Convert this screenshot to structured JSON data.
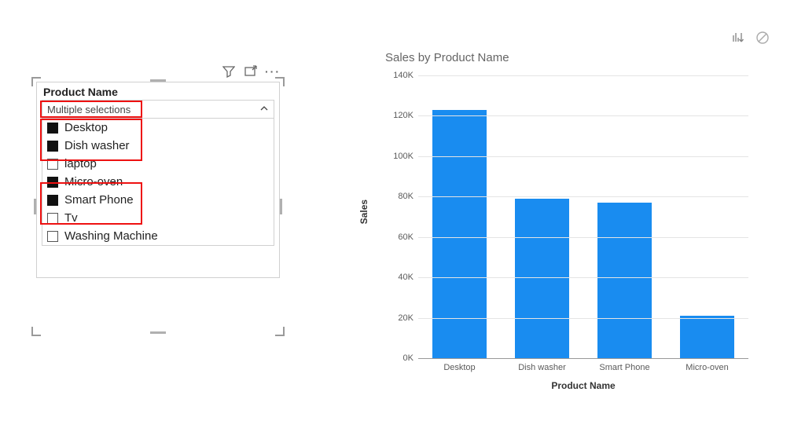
{
  "slicer": {
    "title": "Product Name",
    "dropdown_label": "Multiple selections",
    "items": [
      {
        "label": "Desktop",
        "checked": true
      },
      {
        "label": "Dish washer",
        "checked": true
      },
      {
        "label": "laptop",
        "checked": false
      },
      {
        "label": "Micro-oven",
        "checked": true
      },
      {
        "label": "Smart Phone",
        "checked": true
      },
      {
        "label": "Tv",
        "checked": false
      },
      {
        "label": "Washing Machine",
        "checked": false
      }
    ]
  },
  "chart_icons": {
    "sort": "sort-descending-icon",
    "noentry": "no-entry-icon"
  },
  "slicer_icons": {
    "filter": "filter-icon",
    "focus": "focus-mode-icon",
    "more": "more-options-icon"
  },
  "chart_data": {
    "type": "bar",
    "title": "Sales by Product Name",
    "xlabel": "Product Name",
    "ylabel": "Sales",
    "ylim": [
      0,
      140000
    ],
    "yticks": [
      0,
      20000,
      40000,
      60000,
      80000,
      100000,
      120000,
      140000
    ],
    "ytick_labels": [
      "0K",
      "20K",
      "40K",
      "60K",
      "80K",
      "100K",
      "120K",
      "140K"
    ],
    "categories": [
      "Desktop",
      "Dish washer",
      "Smart Phone",
      "Micro-oven"
    ],
    "values": [
      123000,
      79000,
      77000,
      21000
    ],
    "bar_color": "#198cf0"
  }
}
